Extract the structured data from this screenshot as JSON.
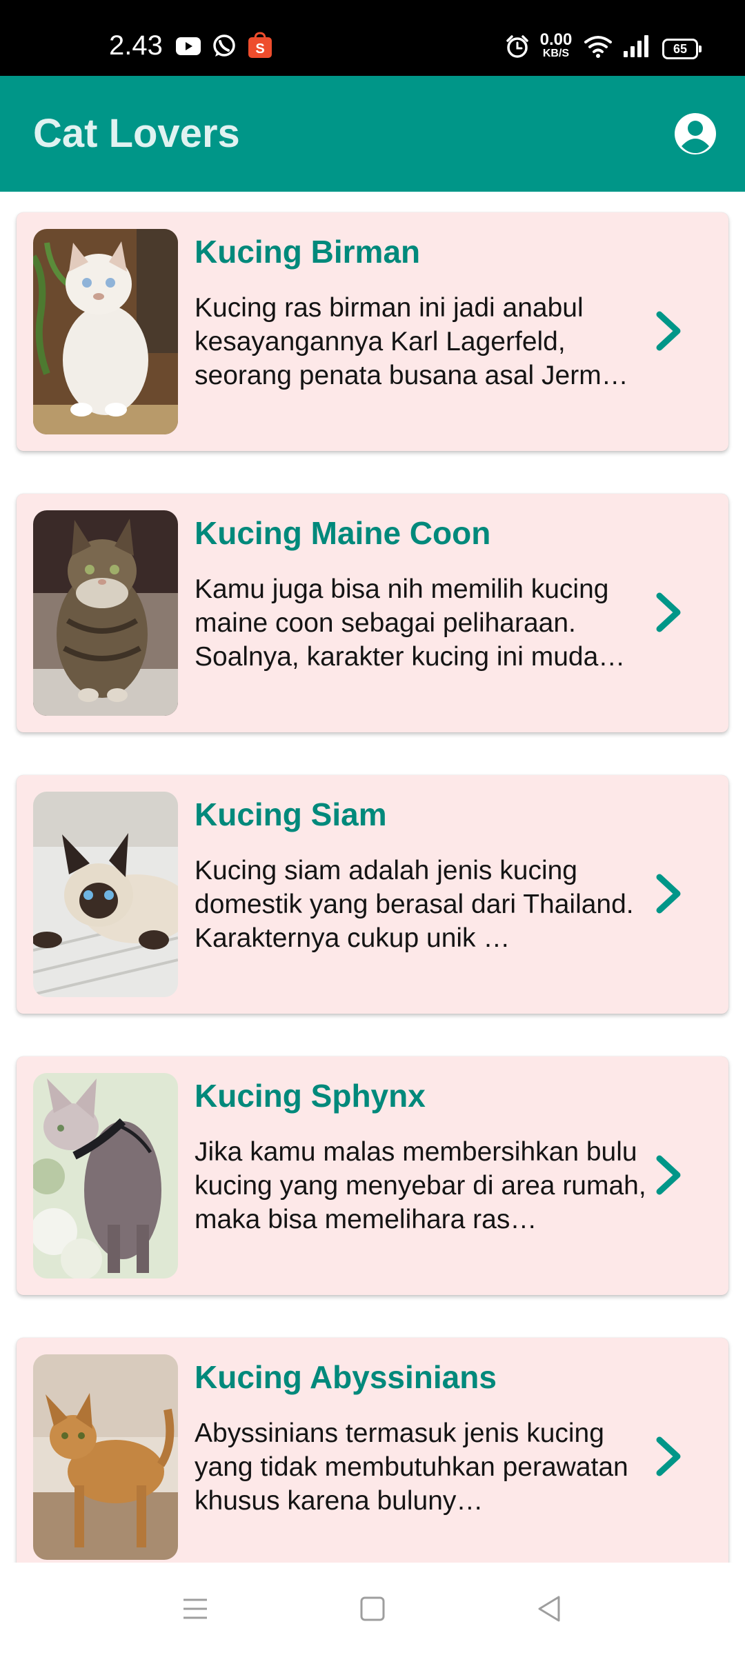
{
  "status_bar": {
    "time": "2.43",
    "net_speed_value": "0.00",
    "net_speed_unit": "KB/S",
    "battery": "65",
    "icons": [
      "youtube-icon",
      "whatsapp-icon",
      "shopee-icon",
      "alarm-icon",
      "wifi-icon",
      "signal-icon",
      "battery-icon"
    ]
  },
  "app_bar": {
    "title": "Cat Lovers",
    "profile_icon": "account-circle-icon"
  },
  "colors": {
    "primary": "#009688",
    "card_background": "#fde8e8",
    "title_text": "#00897b",
    "app_title_text": "#e0f2f1"
  },
  "cats": [
    {
      "title": "Kucing Birman",
      "description": "Kucing ras birman ini jadi anabul kesayangannya Karl Lagerfeld, seorang penata busana asal Jerm…"
    },
    {
      "title": "Kucing Maine Coon",
      "description": "Kamu juga bisa nih memilih kucing maine coon sebagai peliharaan. Soalnya, karakter kucing ini muda…"
    },
    {
      "title": "Kucing Siam",
      "description": "Kucing siam adalah jenis kucing domestik yang berasal dari Thailand. Karakternya cukup unik …"
    },
    {
      "title": "Kucing Sphynx",
      "description": "Jika kamu malas membersihkan bulu kucing yang menyebar di area rumah, maka bisa memelihara ras…"
    },
    {
      "title": "Kucing Abyssinians",
      "description": "Abyssinians termasuk jenis kucing yang tidak membutuhkan perawatan khusus karena buluny…"
    }
  ],
  "nav_bar": {
    "icons": [
      "menu-icon",
      "home-square-icon",
      "back-triangle-icon"
    ]
  }
}
